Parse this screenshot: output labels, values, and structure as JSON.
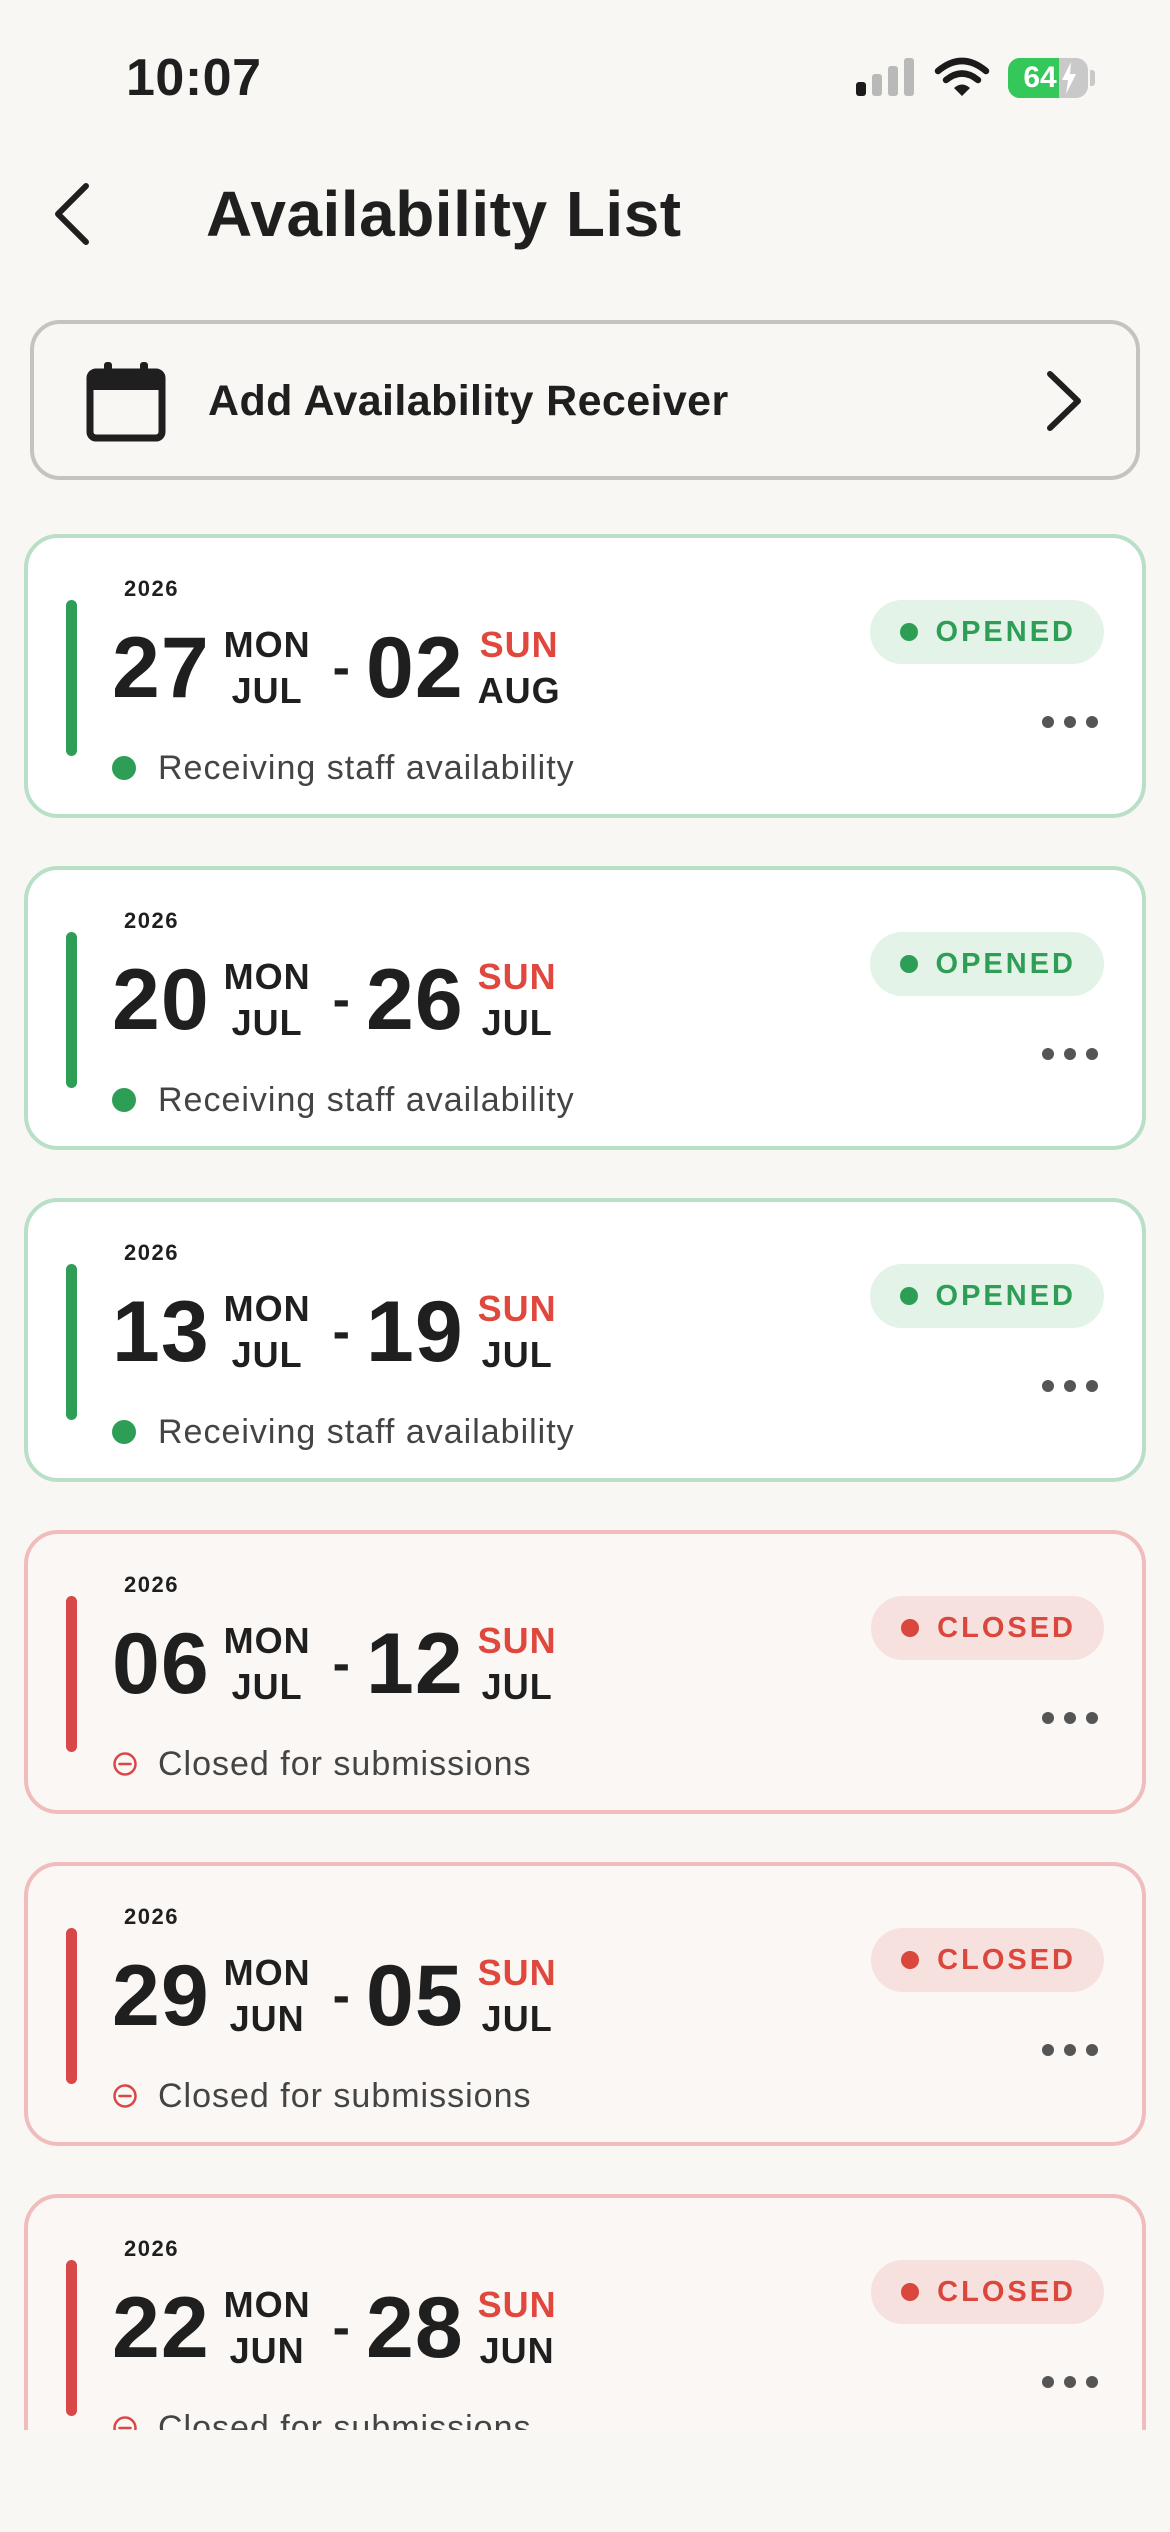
{
  "status_bar": {
    "time": "10:07",
    "battery": "64",
    "battery_level": 0.64
  },
  "header": {
    "title": "Availability List"
  },
  "add_receiver": {
    "label": "Add Availability Receiver"
  },
  "colors": {
    "open": "#2e9e57",
    "closed": "#d94848",
    "sunday": "#e0483e"
  },
  "weeks": [
    {
      "year": "2026",
      "start_day": "27",
      "start_weekday": "MON",
      "start_month": "JUL",
      "end_day": "02",
      "end_weekday": "SUN",
      "end_month": "AUG",
      "status": "OPENED",
      "subtitle": "Receiving staff availability"
    },
    {
      "year": "2026",
      "start_day": "20",
      "start_weekday": "MON",
      "start_month": "JUL",
      "end_day": "26",
      "end_weekday": "SUN",
      "end_month": "JUL",
      "status": "OPENED",
      "subtitle": "Receiving staff availability"
    },
    {
      "year": "2026",
      "start_day": "13",
      "start_weekday": "MON",
      "start_month": "JUL",
      "end_day": "19",
      "end_weekday": "SUN",
      "end_month": "JUL",
      "status": "OPENED",
      "subtitle": "Receiving staff availability"
    },
    {
      "year": "2026",
      "start_day": "06",
      "start_weekday": "MON",
      "start_month": "JUL",
      "end_day": "12",
      "end_weekday": "SUN",
      "end_month": "JUL",
      "status": "CLOSED",
      "subtitle": "Closed for submissions"
    },
    {
      "year": "2026",
      "start_day": "29",
      "start_weekday": "MON",
      "start_month": "JUN",
      "end_day": "05",
      "end_weekday": "SUN",
      "end_month": "JUL",
      "status": "CLOSED",
      "subtitle": "Closed for submissions"
    },
    {
      "year": "2026",
      "start_day": "22",
      "start_weekday": "MON",
      "start_month": "JUN",
      "end_day": "28",
      "end_weekday": "SUN",
      "end_month": "JUN",
      "status": "CLOSED",
      "subtitle": "Closed for submissions"
    }
  ]
}
